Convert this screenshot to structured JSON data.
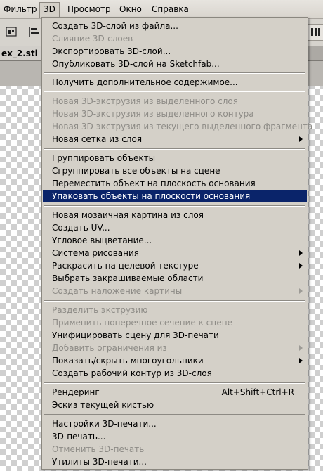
{
  "menubar": {
    "items": [
      "Фильтр",
      "3D",
      "Просмотр",
      "Окно",
      "Справка"
    ]
  },
  "document": {
    "tab_label": "ex_2.stl @"
  },
  "menu": {
    "group1": [
      {
        "label": "Создать 3D-слой из файла...",
        "disabled": false
      },
      {
        "label": "Слияние 3D-слоев",
        "disabled": true
      },
      {
        "label": "Экспортировать 3D-слой...",
        "disabled": false
      },
      {
        "label": "Опубликовать 3D-слой на Sketchfab...",
        "disabled": false
      }
    ],
    "group2": [
      {
        "label": "Получить дополнительное содержимое...",
        "disabled": false
      }
    ],
    "group3": [
      {
        "label": "Новая 3D-экструзия из выделенного слоя",
        "disabled": true
      },
      {
        "label": "Новая 3D-экструзия из выделенного контура",
        "disabled": true
      },
      {
        "label": "Новая 3D-экструзия из текущего выделенного фрагмента",
        "disabled": true
      },
      {
        "label": "Новая сетка из слоя",
        "disabled": false,
        "submenu": true
      }
    ],
    "group4": [
      {
        "label": "Группировать объекты",
        "disabled": false
      },
      {
        "label": "Сгруппировать все объекты на сцене",
        "disabled": false
      },
      {
        "label": "Переместить объект на плоскость основания",
        "disabled": false
      },
      {
        "label": "Упаковать объекты на плоскости основания",
        "disabled": false,
        "highlighted": true
      }
    ],
    "group5": [
      {
        "label": "Новая мозаичная картина из слоя",
        "disabled": false
      },
      {
        "label": "Создать UV...",
        "disabled": false
      },
      {
        "label": "Угловое выцветание...",
        "disabled": false
      },
      {
        "label": "Система рисования",
        "disabled": false,
        "submenu": true
      },
      {
        "label": "Раскрасить на целевой текстуре",
        "disabled": false,
        "submenu": true
      },
      {
        "label": "Выбрать закрашиваемые области",
        "disabled": false
      },
      {
        "label": "Создать наложение картины",
        "disabled": true,
        "submenu": true
      }
    ],
    "group6": [
      {
        "label": "Разделить экструзию",
        "disabled": true
      },
      {
        "label": "Применить поперечное сечение к сцене",
        "disabled": true
      },
      {
        "label": "Унифицировать сцену для 3D-печати",
        "disabled": false
      },
      {
        "label": "Добавить ограничения из",
        "disabled": true,
        "submenu": true
      },
      {
        "label": "Показать/скрыть многоугольники",
        "disabled": false,
        "submenu": true
      },
      {
        "label": "Создать рабочий контур из 3D-слоя",
        "disabled": false
      }
    ],
    "group7": [
      {
        "label": "Рендеринг",
        "disabled": false,
        "shortcut": "Alt+Shift+Ctrl+R"
      },
      {
        "label": "Эскиз текущей кистью",
        "disabled": false
      }
    ],
    "group8": [
      {
        "label": "Настройки 3D-печати...",
        "disabled": false
      },
      {
        "label": "3D-печать...",
        "disabled": false
      },
      {
        "label": "Отменить 3D-печать",
        "disabled": true
      },
      {
        "label": "Утилиты 3D-печати...",
        "disabled": false
      }
    ]
  },
  "colors": {
    "menu_bg": "#d4d0c8",
    "highlight": "#0a246a",
    "disabled_text": "#8d8b86"
  }
}
